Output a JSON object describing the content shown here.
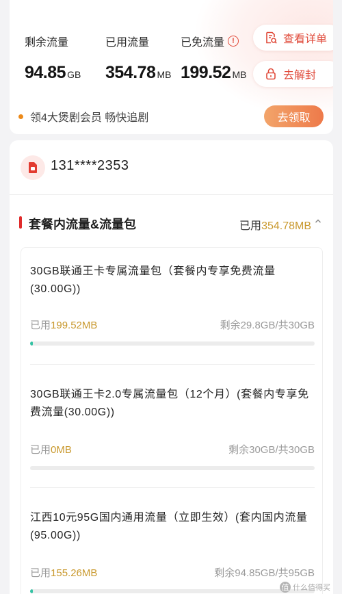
{
  "summary": {
    "remaining": {
      "label": "剩余流量",
      "value": "94.85",
      "unit": "GB"
    },
    "used": {
      "label": "已用流量",
      "value": "354.78",
      "unit": "MB"
    },
    "exempt": {
      "label": "已免流量",
      "value": "199.52",
      "unit": "MB",
      "info_icon": "!"
    }
  },
  "actions": {
    "details_label": "查看详单",
    "unblock_label": "去解封"
  },
  "promo": {
    "text": "领4大煲剧会员 畅快追剧",
    "button_label": "去领取"
  },
  "account": {
    "phone": "131****2353"
  },
  "section": {
    "title": "套餐内流量&流量包",
    "used_prefix": "已用",
    "used_value": "354.78MB"
  },
  "packages": [
    {
      "title": "30GB联通王卡专属流量包（套餐内专享免费流量(30.00G))",
      "used_prefix": "已用",
      "used_value": "199.52MB",
      "remain": "剩余29.8GB/共30GB",
      "progress_fraction": 0.0065
    },
    {
      "title": "30GB联通王卡2.0专属流量包（12个月）(套餐内专享免费流量(30.00G))",
      "used_prefix": "已用",
      "used_value": "0MB",
      "remain": "剩余30GB/共30GB",
      "progress_fraction": 0
    },
    {
      "title": "江西10元95G国内通用流量（立即生效）(套内国内流量(95.00G))",
      "used_prefix": "已用",
      "used_value": "155.26MB",
      "remain": "剩余94.85GB/共95GB",
      "progress_fraction": 0.0016
    }
  ],
  "watermark": {
    "badge": "值",
    "text": "什么值得买"
  },
  "colors": {
    "accent_red": "#e04a3a",
    "gold": "#c9992e",
    "progress_green": "#35c2a4",
    "promo_orange": "#ee7a4a"
  },
  "icons": [
    "info-icon",
    "document-search-icon",
    "lock-icon",
    "sim-card-icon",
    "chevron-up-icon"
  ]
}
